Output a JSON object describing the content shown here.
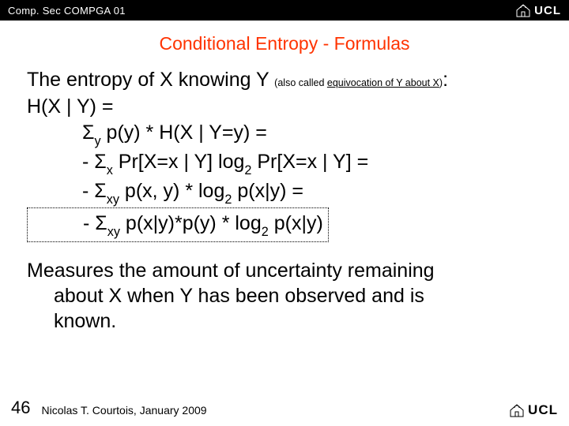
{
  "header": {
    "course_code": "Comp. Sec COMPGA 01",
    "logo_text": "UCL"
  },
  "title": "Conditional Entropy - Formulas",
  "intro": {
    "prefix": "The entropy of X knowing Y ",
    "note_open": "(also called ",
    "note_underlined": "equivocation of Y about X",
    "note_close": ")",
    "suffix": ":"
  },
  "def": "H(X | Y)    =",
  "formulas": {
    "f1_a": "Σ",
    "f1_sub": "y",
    "f1_b": " p(y) * H(X | Y=y) =",
    "f2_a": "- Σ",
    "f2_sub": "x",
    "f2_b": "  Pr[X=x | Y] log",
    "f2_sub2": "2",
    "f2_c": " Pr[X=x | Y] =",
    "f3_a": "- Σ",
    "f3_sub": "xy",
    "f3_b": "  p(x, y) * log",
    "f3_sub2": "2",
    "f3_c": " p(x|y) =",
    "f4_a": "- Σ",
    "f4_sub": "xy",
    "f4_b": " p(x|y)*p(y) * log",
    "f4_sub2": "2",
    "f4_c": " p(x|y)"
  },
  "body": {
    "line1": "Measures the amount of uncertainty remaining",
    "line2": "about X when Y has been observed and is",
    "line3": "known."
  },
  "footer": {
    "page": "46",
    "author": "Nicolas T. Courtois, January 2009",
    "logo_text": "UCL"
  }
}
